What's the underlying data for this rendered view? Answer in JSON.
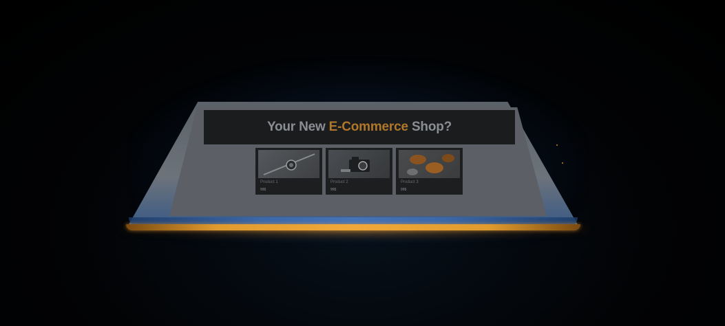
{
  "hero": {
    "title_prefix": "Your New ",
    "title_accent": "E-Commerce",
    "title_suffix": " Shop?"
  },
  "products": [
    {
      "name": "Product 1",
      "price": "99$",
      "image_icon": "watch-icon"
    },
    {
      "name": "Product 2",
      "price": "99$",
      "image_icon": "camera-icon"
    },
    {
      "name": "Product 3",
      "price": "99$",
      "image_icon": "food-icon"
    }
  ],
  "colors": {
    "accent": "#b0772a",
    "glow_blue": "#3b6ab0",
    "glow_orange": "#f0a83a",
    "background": "#000000"
  }
}
